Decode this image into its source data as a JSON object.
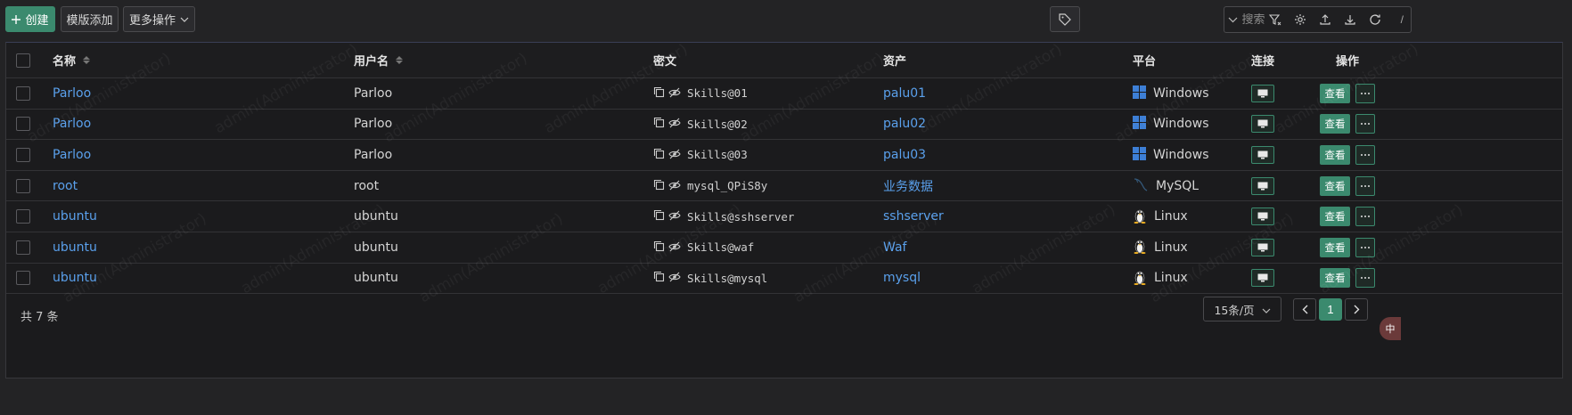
{
  "toolbar": {
    "create_label": "创建",
    "template_add_label": "模版添加",
    "more_actions_label": "更多操作",
    "search_placeholder": "搜索",
    "search_shortcut": "/"
  },
  "table": {
    "headers": {
      "name": "名称",
      "username": "用户名",
      "secret": "密文",
      "asset": "资产",
      "platform": "平台",
      "connect": "连接",
      "actions": "操作"
    },
    "rows": [
      {
        "name": "Parloo",
        "username": "Parloo",
        "secret": "Skills@01",
        "asset": "palu01",
        "platform": "Windows",
        "platform_icon": "windows-icon"
      },
      {
        "name": "Parloo",
        "username": "Parloo",
        "secret": "Skills@02",
        "asset": "palu02",
        "platform": "Windows",
        "platform_icon": "windows-icon"
      },
      {
        "name": "Parloo",
        "username": "Parloo",
        "secret": "Skills@03",
        "asset": "palu03",
        "platform": "Windows",
        "platform_icon": "windows-icon"
      },
      {
        "name": "root",
        "username": "root",
        "secret": "mysql_QPiS8y",
        "asset": "业务数据",
        "platform": "MySQL",
        "platform_icon": "mysql-icon"
      },
      {
        "name": "ubuntu",
        "username": "ubuntu",
        "secret": "Skills@sshserver",
        "asset": "sshserver",
        "platform": "Linux",
        "platform_icon": "linux-icon"
      },
      {
        "name": "ubuntu",
        "username": "ubuntu",
        "secret": "Skills@waf",
        "asset": "Waf",
        "platform": "Linux",
        "platform_icon": "linux-icon"
      },
      {
        "name": "ubuntu",
        "username": "ubuntu",
        "secret": "Skills@mysql",
        "asset": "mysql",
        "platform": "Linux",
        "platform_icon": "linux-icon"
      }
    ],
    "view_label": "查看"
  },
  "footer": {
    "total_label": "共 7 条",
    "page_size_label": "15条/页",
    "current_page": "1"
  },
  "watermark": "admin(Administrator)",
  "colors": {
    "accent": "#3b8a6e",
    "link": "#5aa0ec",
    "background": "#232325"
  }
}
